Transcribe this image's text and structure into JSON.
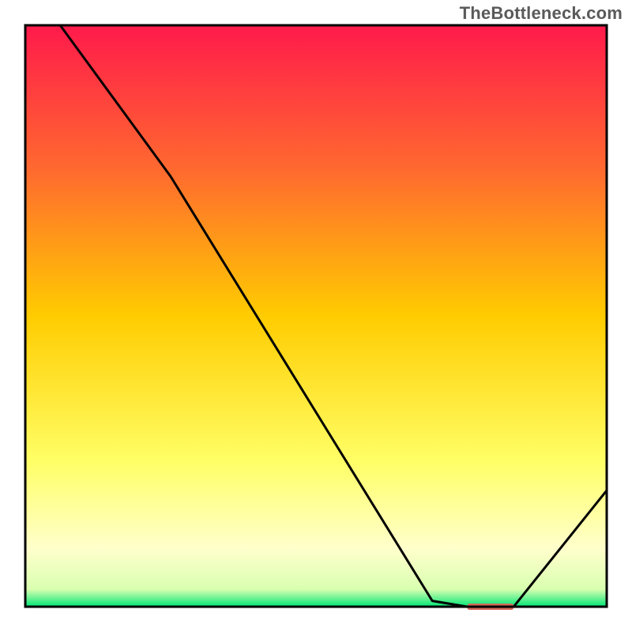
{
  "watermark": "TheBottleneck.com",
  "chart_data": {
    "type": "line",
    "title": "",
    "xlabel": "",
    "ylabel": "",
    "xlim": [
      0,
      100
    ],
    "ylim": [
      0,
      100
    ],
    "grid": false,
    "legend": false,
    "background_gradient_stops": [
      {
        "y": 0,
        "color": "#ff1a4b"
      },
      {
        "y": 25,
        "color": "#ff6a2f"
      },
      {
        "y": 50,
        "color": "#ffcc00"
      },
      {
        "y": 75,
        "color": "#ffff66"
      },
      {
        "y": 90,
        "color": "#ffffcc"
      },
      {
        "y": 97,
        "color": "#d9ffb0"
      },
      {
        "y": 100,
        "color": "#00e676"
      }
    ],
    "series": [
      {
        "name": "bottleneck-curve",
        "x": [
          6,
          25,
          70,
          76,
          84,
          100
        ],
        "y": [
          100,
          74,
          1,
          0,
          0,
          20
        ]
      }
    ],
    "marker": {
      "name": "optimal-range-marker",
      "x_start": 76,
      "x_end": 84,
      "y": 0,
      "color": "#d36a5a"
    },
    "frame": {
      "x": 4,
      "y": 4,
      "w": 92,
      "h": 92
    }
  }
}
